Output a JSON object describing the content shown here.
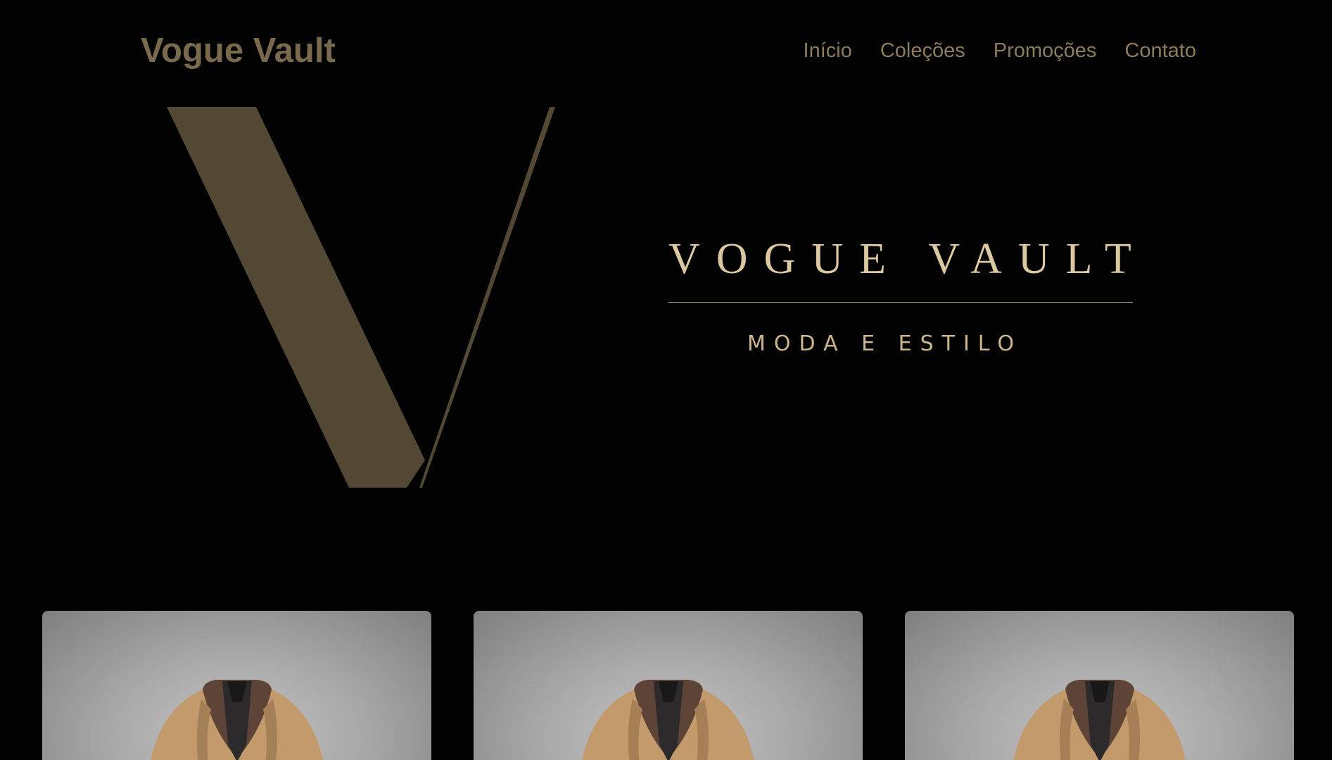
{
  "header": {
    "logo": "Vogue Vault",
    "nav": [
      "Início",
      "Coleções",
      "Promoções",
      "Contato"
    ]
  },
  "hero": {
    "monogram_icon": "v-monogram-icon",
    "title": "VOGUE VAULT",
    "subtitle": "MODA E ESTILO"
  },
  "products": [
    {
      "image": "camel-coat-with-shearling-collar"
    },
    {
      "image": "camel-coat-with-shearling-collar"
    },
    {
      "image": "camel-coat-with-shearling-collar"
    }
  ],
  "colors": {
    "background": "#020202",
    "logo": "#7a6a4d",
    "nav": "#8c7c5c",
    "monogram": "#524834",
    "title": "#dcc8a0",
    "subtitle": "#cbb68d",
    "rule": "#b9a887"
  }
}
